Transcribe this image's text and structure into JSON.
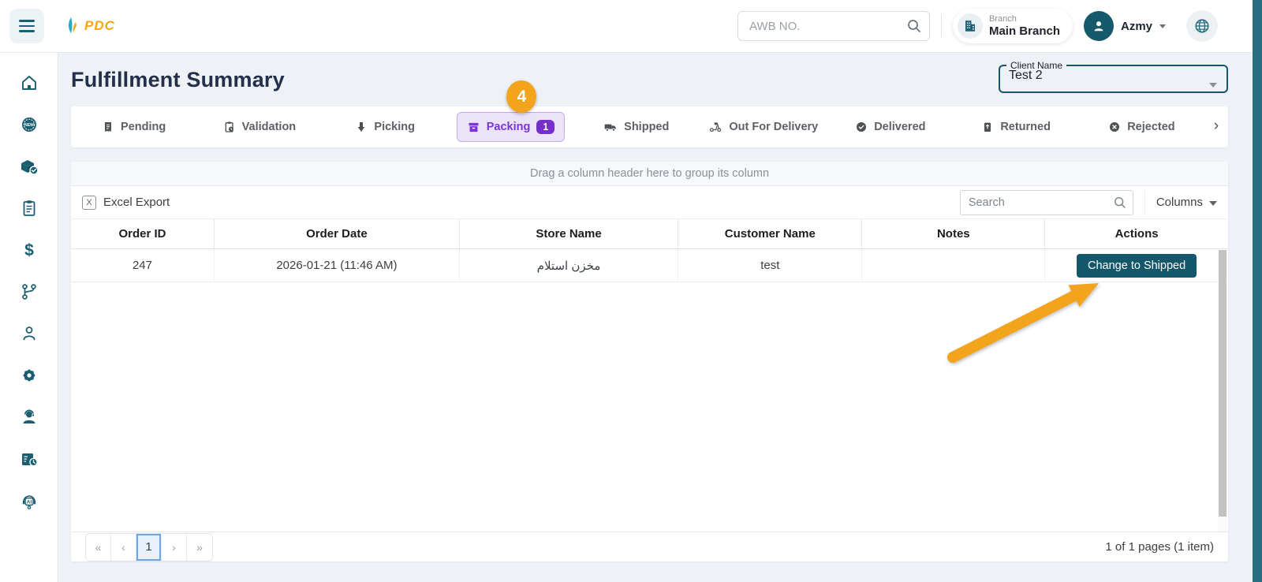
{
  "colors": {
    "brand_teal": "#15596B",
    "accent_purple": "#7B35D6",
    "badge_purple": "#7430C9",
    "annotation_orange": "#F2A41D",
    "pager_blue": "#6CA7E3",
    "page_bg": "#EEF1F5"
  },
  "topbar": {
    "logo": "PDC",
    "awb_placeholder": "AWB NO.",
    "branch_label": "Branch",
    "branch_value": "Main Branch",
    "user_name": "Azmy"
  },
  "sidebar": {
    "icons": [
      "home-icon",
      "new-badge-icon",
      "package-check-icon",
      "orders-clipboard-icon",
      "finance-dollar-icon",
      "workflow-branch-icon",
      "users-icon",
      "settings-gear-icon",
      "support-agent-icon",
      "package-schedule-icon",
      "ai-assistant-icon"
    ]
  },
  "page": {
    "title": "Fulfillment Summary"
  },
  "client_filter": {
    "label": "Client Name",
    "value": "Test 2"
  },
  "tabs": {
    "items": [
      {
        "label": "Pending",
        "icon": "receipt-icon"
      },
      {
        "label": "Validation",
        "icon": "clipboard-clock-icon"
      },
      {
        "label": "Picking",
        "icon": "hand-down-icon"
      },
      {
        "label": "Packing",
        "icon": "box-icon",
        "badge": "1",
        "active": true
      },
      {
        "label": "Shipped",
        "icon": "truck-icon"
      },
      {
        "label": "Out For Delivery",
        "icon": "scooter-icon"
      },
      {
        "label": "Delivered",
        "icon": "check-circle-icon"
      },
      {
        "label": "Returned",
        "icon": "return-box-icon"
      },
      {
        "label": "Rejected",
        "icon": "x-circle-icon"
      }
    ],
    "more": "›"
  },
  "annotation": {
    "step_number": "4"
  },
  "grid": {
    "group_hint": "Drag a column header here to group its column",
    "excel_export": "Excel Export",
    "excel_icon": "X",
    "search_placeholder": "Search",
    "columns_label": "Columns",
    "headers": [
      "Order ID",
      "Order Date",
      "Store Name",
      "Customer Name",
      "Notes",
      "Actions"
    ],
    "rows": [
      {
        "order_id": "247",
        "order_date": "2026-01-21 (11:46 AM)",
        "store_name": "مخزن استلام",
        "customer_name": "test",
        "notes": "",
        "action": "Change to Shipped"
      }
    ],
    "pagination": {
      "first": "«",
      "prev": "‹",
      "page": "1",
      "next": "›",
      "last": "»",
      "summary": "1 of 1 pages (1 item)"
    }
  }
}
